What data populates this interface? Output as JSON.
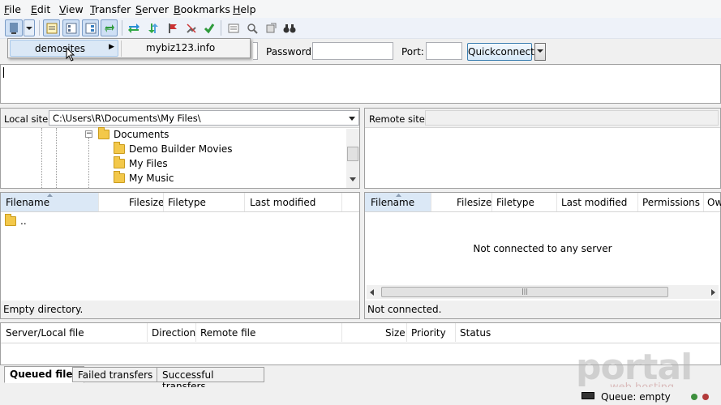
{
  "menubar": {
    "items": [
      {
        "label": "File",
        "key": "F"
      },
      {
        "label": "Edit",
        "key": "E"
      },
      {
        "label": "View",
        "key": "V"
      },
      {
        "label": "Transfer",
        "key": "T"
      },
      {
        "label": "Server",
        "key": "S"
      },
      {
        "label": "Bookmarks",
        "key": "B"
      },
      {
        "label": "Help",
        "key": "H"
      }
    ]
  },
  "bookmark_popup": {
    "items": [
      {
        "label": "demosites"
      },
      {
        "label": "mybiz123.info"
      }
    ]
  },
  "quickconnect": {
    "password_label": "Password:",
    "port_label": "Port:",
    "password_value": "",
    "port_value": "",
    "button_label": "Quickconnect"
  },
  "local": {
    "site_label": "Local site:",
    "path": "C:\\Users\\R\\Documents\\My Files\\",
    "tree": [
      "Documents",
      "Demo Builder Movies",
      "My Files",
      "My Music"
    ],
    "columns": [
      "Filename",
      "Filesize",
      "Filetype",
      "Last modified"
    ],
    "rows": [
      ".."
    ],
    "status": "Empty directory."
  },
  "remote": {
    "site_label": "Remote site:",
    "path": "",
    "columns": [
      "Filename",
      "Filesize",
      "Filetype",
      "Last modified",
      "Permissions",
      "Ow"
    ],
    "empty_message": "Not connected to any server",
    "status": "Not connected."
  },
  "queue": {
    "columns": [
      "Server/Local file",
      "Direction",
      "Remote file",
      "Size",
      "Priority",
      "Status"
    ],
    "tabs": [
      "Queued files",
      "Failed transfers",
      "Successful transfers"
    ],
    "status": "Queue: empty"
  },
  "watermark": {
    "text": "portal",
    "subtext": "web hosting"
  },
  "colors": {
    "accent": "#3c7fb1",
    "selection": "#dbe8f6",
    "watermark": "#b5b5b5"
  }
}
